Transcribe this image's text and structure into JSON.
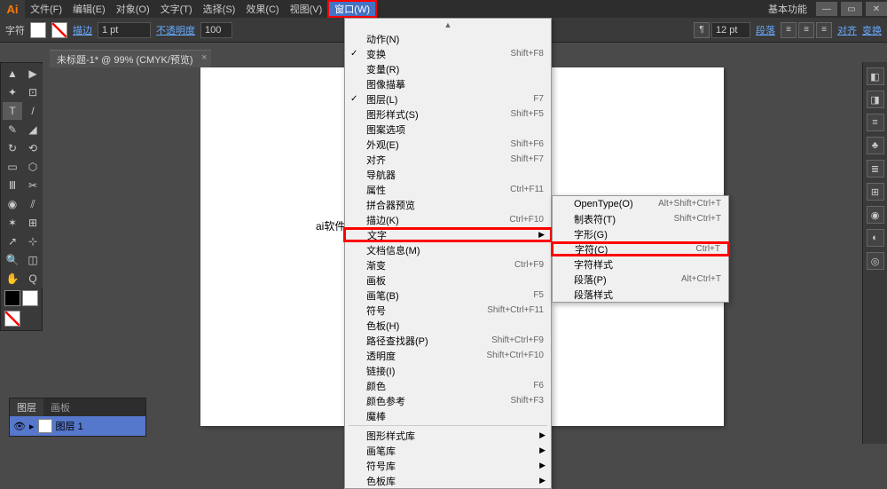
{
  "app": {
    "icon": "Ai",
    "basic": "基本功能"
  },
  "menu": [
    "文件(F)",
    "编辑(E)",
    "对象(O)",
    "文字(T)",
    "选择(S)",
    "效果(C)",
    "视图(V)",
    "窗口(W)"
  ],
  "menu_active_index": 7,
  "control": {
    "char_label": "字符",
    "stroke": "描边",
    "stroke_pt": "1 pt",
    "opacity_label": "不透明度",
    "opacity": "100",
    "pt_val": "12 pt",
    "align": "段落",
    "align2": "对齐",
    "transform": "变换"
  },
  "doc": {
    "tab": "未标题-1* @ 99% (CMYK/预览)"
  },
  "page_text": "ai软件的!",
  "layers": {
    "tab1": "图层",
    "tab2": "画板",
    "row": "图层 1"
  },
  "dropdown": [
    {
      "t": "scroll",
      "v": "▲"
    },
    {
      "t": "item",
      "label": "动作(N)"
    },
    {
      "t": "item",
      "label": "变换",
      "sc": "Shift+F8",
      "check": true
    },
    {
      "t": "item",
      "label": "变量(R)"
    },
    {
      "t": "item",
      "label": "图像描摹"
    },
    {
      "t": "item",
      "label": "图层(L)",
      "sc": "F7",
      "check": true
    },
    {
      "t": "item",
      "label": "图形样式(S)",
      "sc": "Shift+F5"
    },
    {
      "t": "item",
      "label": "图案选项"
    },
    {
      "t": "item",
      "label": "外观(E)",
      "sc": "Shift+F6"
    },
    {
      "t": "item",
      "label": "对齐",
      "sc": "Shift+F7"
    },
    {
      "t": "item",
      "label": "导航器"
    },
    {
      "t": "item",
      "label": "属性",
      "sc": "Ctrl+F11"
    },
    {
      "t": "item",
      "label": "拼合器预览"
    },
    {
      "t": "item",
      "label": "描边(K)",
      "sc": "Ctrl+F10"
    },
    {
      "t": "item",
      "label": "文字",
      "arrow": true,
      "hl": true
    },
    {
      "t": "item",
      "label": "文档信息(M)"
    },
    {
      "t": "item",
      "label": "渐变",
      "sc": "Ctrl+F9"
    },
    {
      "t": "item",
      "label": "画板",
      "sc": ""
    },
    {
      "t": "item",
      "label": "画笔(B)",
      "sc": "F5"
    },
    {
      "t": "item",
      "label": "符号",
      "sc": "Shift+Ctrl+F11"
    },
    {
      "t": "item",
      "label": "色板(H)"
    },
    {
      "t": "item",
      "label": "路径查找器(P)",
      "sc": "Shift+Ctrl+F9"
    },
    {
      "t": "item",
      "label": "透明度",
      "sc": "Shift+Ctrl+F10"
    },
    {
      "t": "item",
      "label": "链接(I)"
    },
    {
      "t": "item",
      "label": "颜色",
      "sc": "F6"
    },
    {
      "t": "item",
      "label": "颜色参考",
      "sc": "Shift+F3"
    },
    {
      "t": "item",
      "label": "魔棒"
    },
    {
      "t": "sep"
    },
    {
      "t": "item",
      "label": "图形样式库",
      "arrow": true
    },
    {
      "t": "item",
      "label": "画笔库",
      "arrow": true
    },
    {
      "t": "item",
      "label": "符号库",
      "arrow": true
    },
    {
      "t": "item",
      "label": "色板库",
      "arrow": true
    }
  ],
  "submenu": [
    {
      "label": "OpenType(O)",
      "sc": "Alt+Shift+Ctrl+T"
    },
    {
      "label": "制表符(T)",
      "sc": "Shift+Ctrl+T"
    },
    {
      "label": "字形(G)"
    },
    {
      "label": "字符(C)",
      "sc": "Ctrl+T",
      "hl": true
    },
    {
      "label": "字符样式"
    },
    {
      "label": "段落(P)",
      "sc": "Alt+Ctrl+T"
    },
    {
      "label": "段落样式"
    }
  ],
  "tool_glyphs": [
    "▲",
    "▶",
    "✦",
    "⊡",
    "T",
    "/",
    "✎",
    "◢",
    "↻",
    "⟲",
    "▭",
    "⬡",
    "Ⅲ",
    "✂",
    "◉",
    "⫽",
    "✶",
    "⊞",
    "↗",
    "⊹",
    "🔍",
    "◫",
    "✋",
    "Q"
  ],
  "dock_glyphs": [
    "◧",
    "◨",
    "≡",
    "♣",
    "≣",
    "⊞",
    "◉",
    "◐",
    "◎"
  ]
}
